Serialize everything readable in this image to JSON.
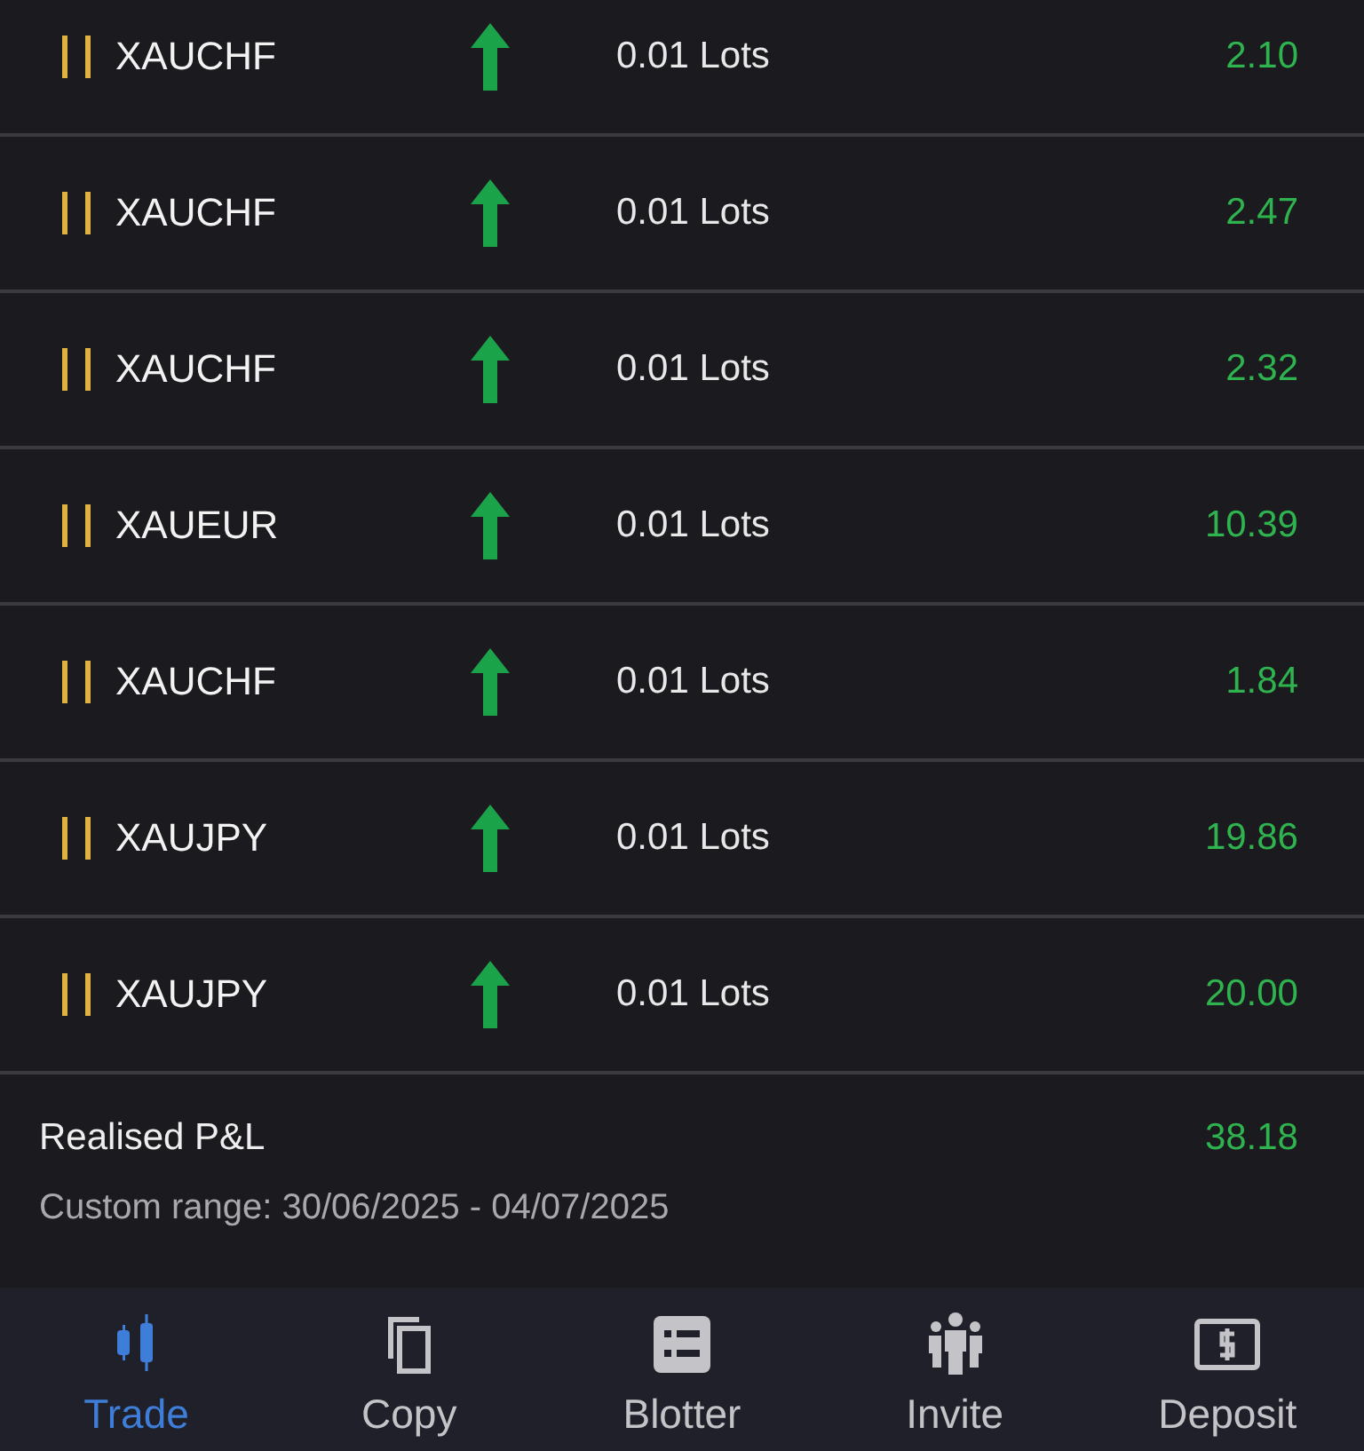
{
  "positions": [
    {
      "symbol": "XAUCHF",
      "kind": "up",
      "volume": "0.01 Lots",
      "profit": "2.10"
    },
    {
      "symbol": "XAUCHF",
      "kind": "up",
      "volume": "0.01 Lots",
      "profit": "2.47"
    },
    {
      "symbol": "XAUCHF",
      "kind": "up",
      "volume": "0.01 Lots",
      "profit": "2.32"
    },
    {
      "symbol": "XAUEUR",
      "kind": "up",
      "volume": "0.01 Lots",
      "profit": "10.39"
    },
    {
      "symbol": "XAUCHF",
      "kind": "up",
      "volume": "0.01 Lots",
      "profit": "1.84"
    },
    {
      "symbol": "XAUJPY",
      "kind": "up",
      "volume": "0.01 Lots",
      "profit": "19.86"
    },
    {
      "symbol": "XAUJPY",
      "kind": "up",
      "volume": "0.01 Lots",
      "profit": "20.00"
    }
  ],
  "summary": {
    "label": "Realised P&L",
    "value": "38.18",
    "range": "Custom range: 30/06/2025 - 04/07/2025"
  },
  "nav": [
    {
      "kind": "trade",
      "label": "Trade",
      "selected": true
    },
    {
      "kind": "copy",
      "label": "Copy",
      "selected": false
    },
    {
      "kind": "blotter",
      "label": "Blotter",
      "selected": false
    },
    {
      "kind": "invite",
      "label": "Invite",
      "selected": false
    },
    {
      "kind": "deposit",
      "label": "Deposit",
      "selected": false
    }
  ]
}
